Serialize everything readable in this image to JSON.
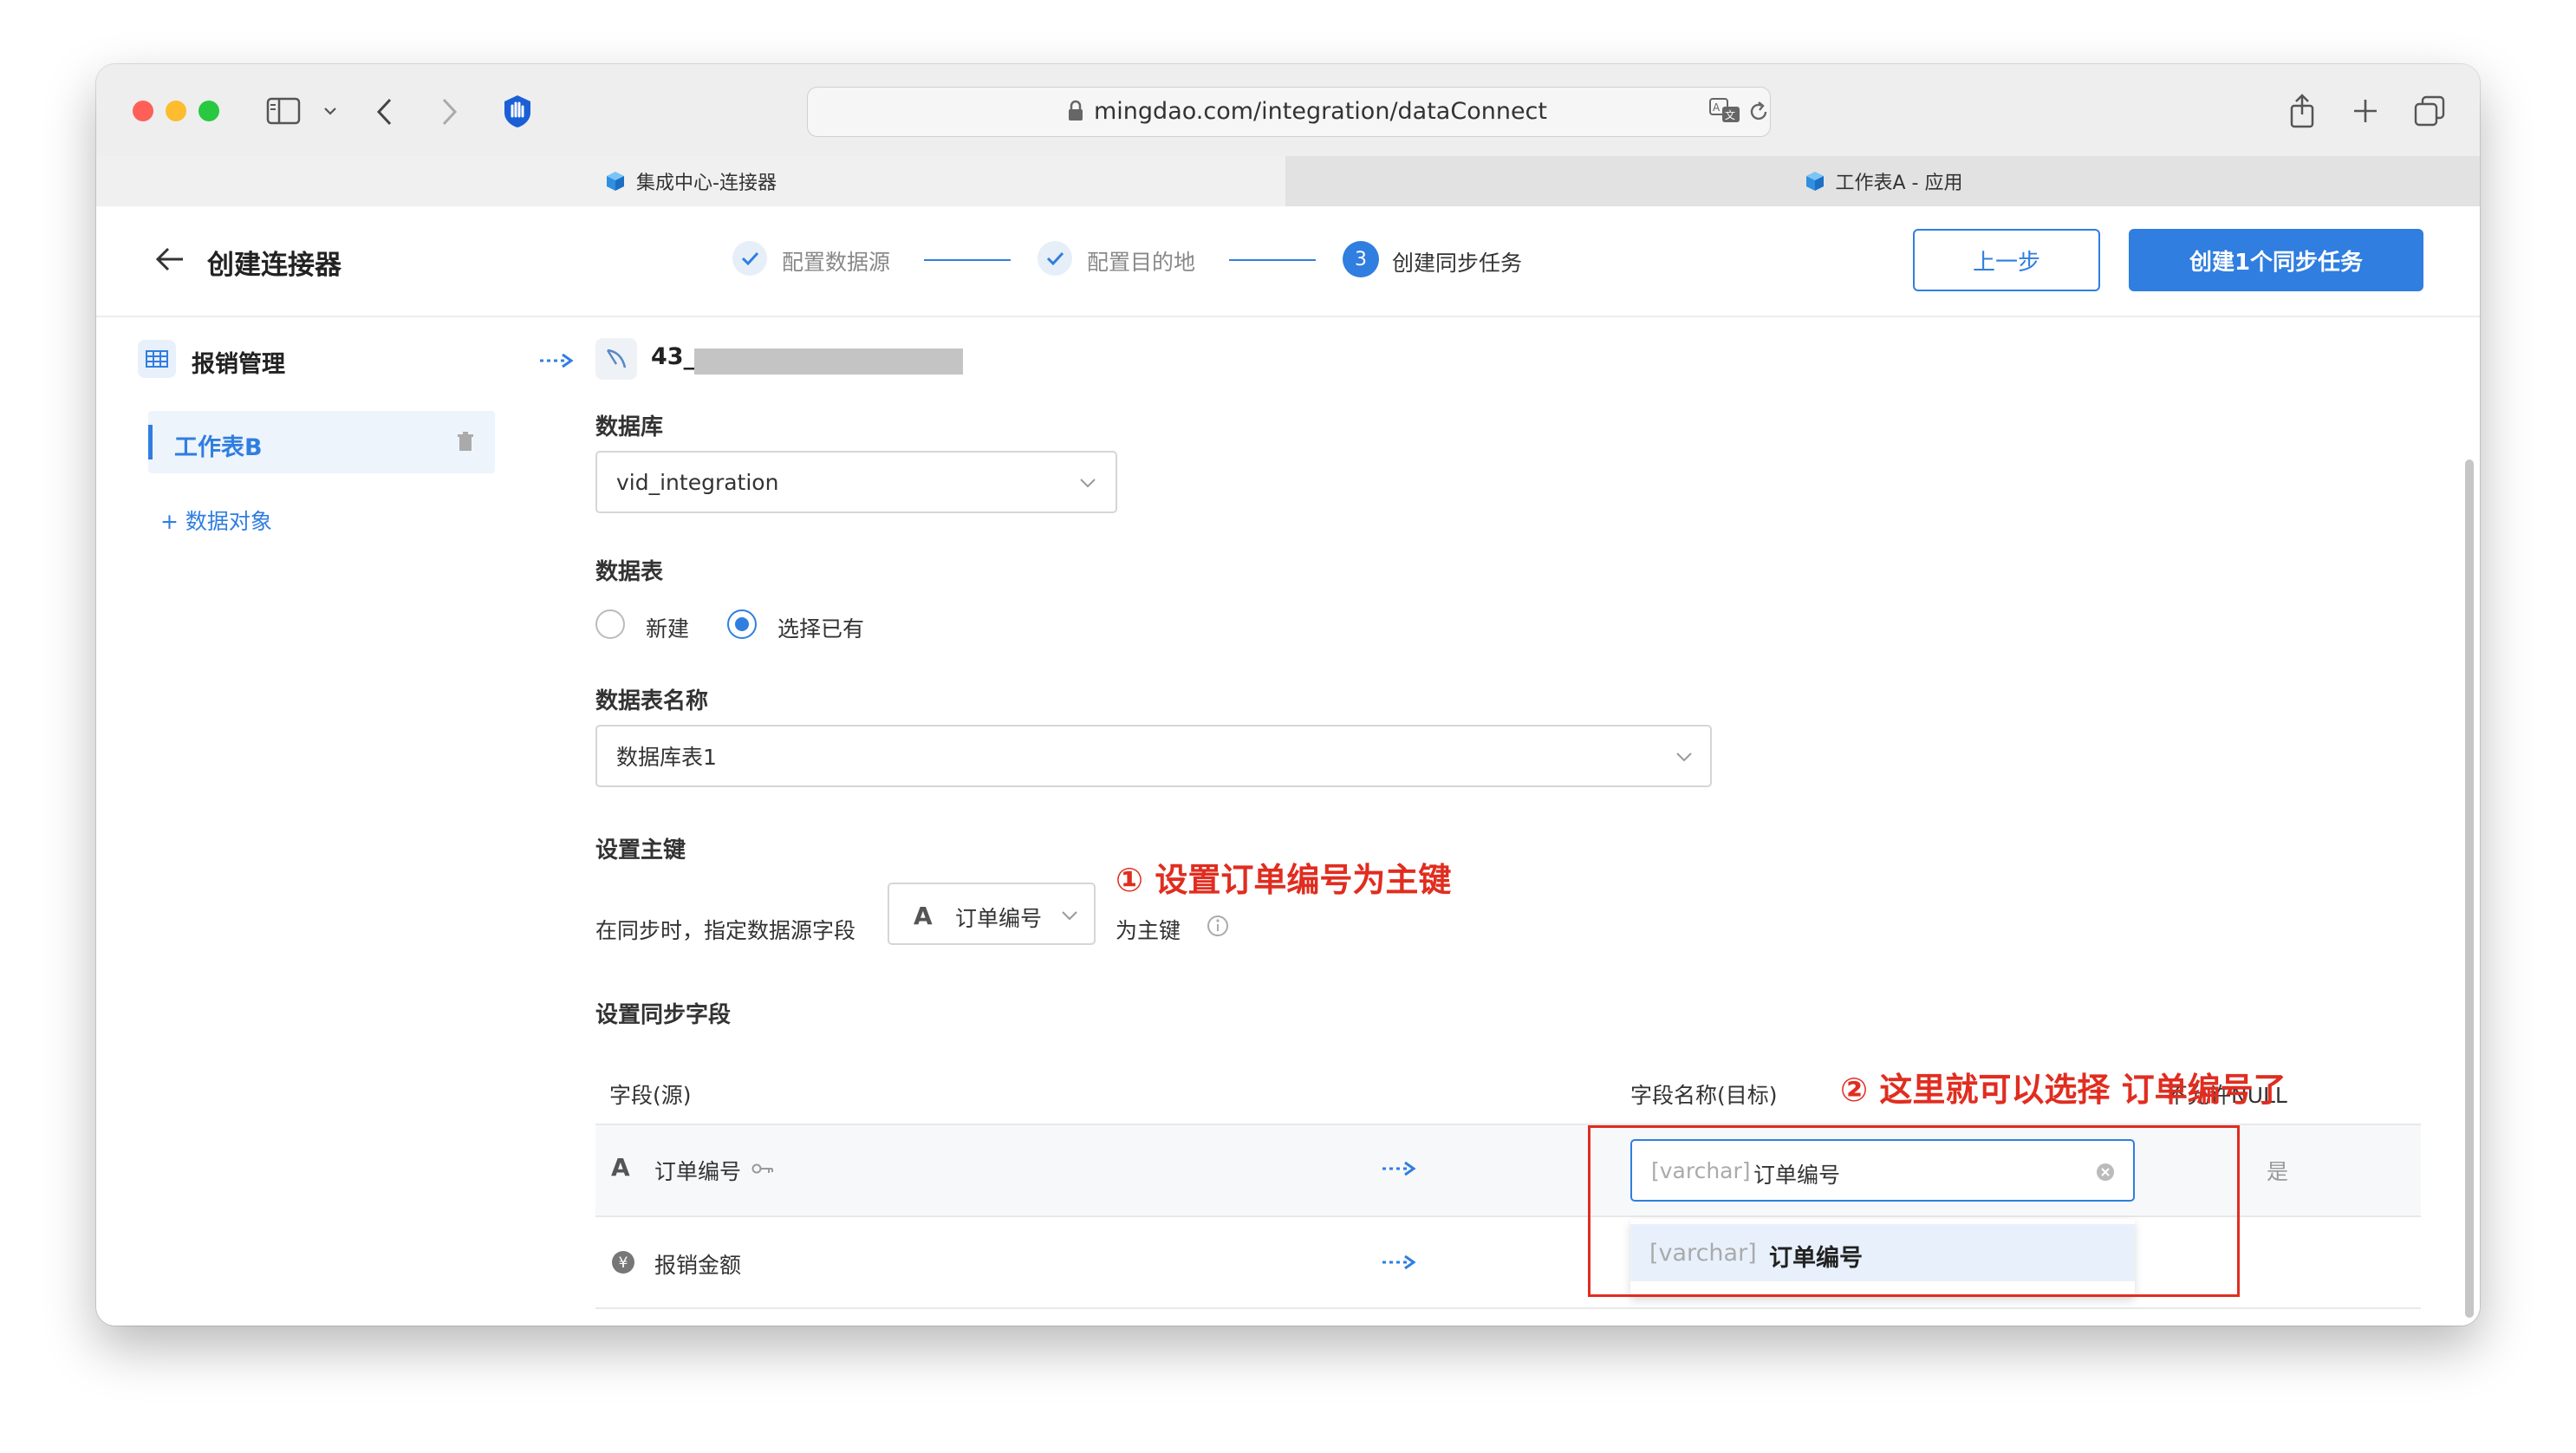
{
  "browser": {
    "url": "mingdao.com/integration/dataConnect",
    "tabs": [
      {
        "label": "集成中心-连接器",
        "active": true
      },
      {
        "label": "工作表A - 应用",
        "active": false
      }
    ]
  },
  "header": {
    "back_title": "创建连接器",
    "steps": [
      {
        "label": "配置数据源",
        "state": "done"
      },
      {
        "label": "配置目的地",
        "state": "done"
      },
      {
        "label": "创建同步任务",
        "state": "active",
        "number": "3"
      }
    ],
    "prev_button": "上一步",
    "create_button": "创建1个同步任务"
  },
  "sidebar": {
    "source_name": "报销管理",
    "worksheet": "工作表B",
    "add_object": "+ 数据对象"
  },
  "form": {
    "connection_name": "43_",
    "database_label": "数据库",
    "database_value": "vid_integration",
    "table_label": "数据表",
    "radio_new": "新建",
    "radio_existing": "选择已有",
    "table_name_label": "数据表名称",
    "table_name_value": "数据库表1",
    "pk_label": "设置主键",
    "pk_prefix": "在同步时，指定数据源字段",
    "pk_field": "订单编号",
    "pk_suffix": "为主键",
    "sync_fields_label": "设置同步字段",
    "col_source": "字段(源)",
    "col_target": "字段名称(目标)",
    "col_null": "不允许NULL",
    "rows": [
      {
        "source": "订单编号",
        "type_tag": "[varchar]",
        "target": "订单编号",
        "not_null": "是"
      },
      {
        "source": "报销金额"
      }
    ],
    "dropdown_option": {
      "type_tag": "[varchar]",
      "label": "订单编号"
    }
  },
  "annotations": {
    "note1": "① 设置订单编号为主键",
    "note2": "② 这里就可以选择 订单编号了"
  },
  "colors": {
    "accent": "#2f7ee0",
    "annotation_red": "#e02d20"
  }
}
